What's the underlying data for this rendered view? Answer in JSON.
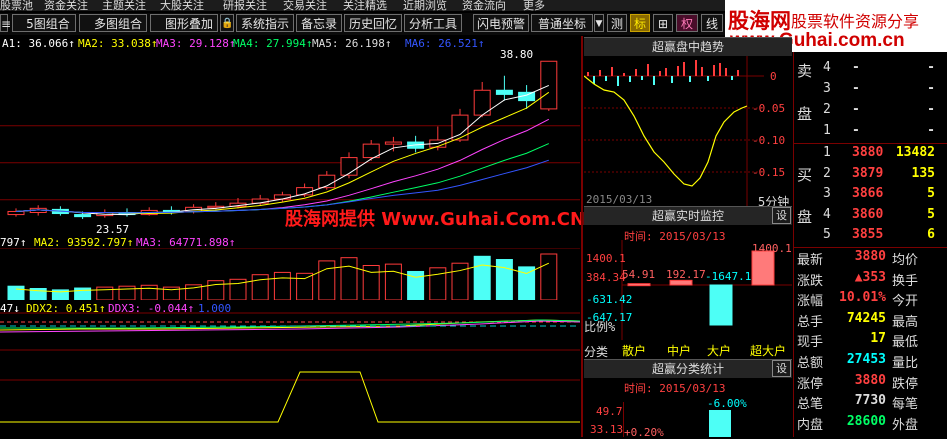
{
  "menu_top": [
    "股票池",
    "资金关注",
    "主题关注",
    "大股关注",
    "研报关注",
    "交易关注",
    "关注精选",
    "近期浏览",
    "资金流向",
    "更多"
  ],
  "toolbar": {
    "items": [
      "5图组合",
      "多图组合",
      "图形叠加",
      "系统指示",
      "备忘录",
      "历史回忆",
      "分析工具",
      "闪电预警",
      "普通坐标"
    ],
    "toggles": [
      "测",
      "标",
      "⊞",
      "权",
      "线"
    ]
  },
  "logo": {
    "main": "股海网",
    "sub": "股票软件资源分享",
    "url": "www.Guhai.com.cn"
  },
  "watermark": "股海网提供 Www.Guhai.Com.CN",
  "main_chart": {
    "ma_line": [
      "A1: 36.066↑",
      "MA2: 33.038↑",
      "MA3: 29.128↑",
      "MA4: 27.994↑",
      "MA5: 26.198↑",
      "MA6: 26.521↑"
    ],
    "ma_colors": [
      "#ffffff",
      "#ffff00",
      "#ff44ff",
      "#00ff66",
      "#dddddd",
      "#3355ff"
    ],
    "high_label": "38.80",
    "low_label": "23.57",
    "candles": [
      {
        "o": 24.0,
        "c": 24.3,
        "h": 24.6,
        "l": 23.8
      },
      {
        "o": 24.2,
        "c": 24.6,
        "h": 24.9,
        "l": 23.9
      },
      {
        "o": 24.5,
        "c": 24.1,
        "h": 24.8,
        "l": 23.9
      },
      {
        "o": 24.0,
        "c": 23.8,
        "h": 24.3,
        "l": 23.57
      },
      {
        "o": 23.9,
        "c": 24.2,
        "h": 24.5,
        "l": 23.7
      },
      {
        "o": 24.2,
        "c": 24.0,
        "h": 24.6,
        "l": 23.8
      },
      {
        "o": 24.0,
        "c": 24.4,
        "h": 24.7,
        "l": 23.9
      },
      {
        "o": 24.4,
        "c": 24.3,
        "h": 24.8,
        "l": 24.0
      },
      {
        "o": 24.3,
        "c": 24.7,
        "h": 25.0,
        "l": 24.1
      },
      {
        "o": 24.7,
        "c": 24.8,
        "h": 25.2,
        "l": 24.5
      },
      {
        "o": 24.8,
        "c": 25.1,
        "h": 25.6,
        "l": 24.6
      },
      {
        "o": 25.1,
        "c": 25.5,
        "h": 25.9,
        "l": 24.9
      },
      {
        "o": 25.5,
        "c": 25.9,
        "h": 26.2,
        "l": 25.2
      },
      {
        "o": 25.9,
        "c": 26.6,
        "h": 27.0,
        "l": 25.7
      },
      {
        "o": 26.6,
        "c": 27.8,
        "h": 28.2,
        "l": 26.4
      },
      {
        "o": 27.8,
        "c": 29.5,
        "h": 30.0,
        "l": 27.5
      },
      {
        "o": 29.5,
        "c": 30.8,
        "h": 31.2,
        "l": 29.2
      },
      {
        "o": 30.8,
        "c": 31.0,
        "h": 31.5,
        "l": 30.1
      },
      {
        "o": 31.0,
        "c": 30.4,
        "h": 31.6,
        "l": 30.0
      },
      {
        "o": 30.5,
        "c": 31.2,
        "h": 32.5,
        "l": 30.2
      },
      {
        "o": 31.2,
        "c": 33.6,
        "h": 34.2,
        "l": 31.0
      },
      {
        "o": 33.6,
        "c": 36.0,
        "h": 36.8,
        "l": 33.4
      },
      {
        "o": 36.0,
        "c": 35.6,
        "h": 37.4,
        "l": 35.0
      },
      {
        "o": 35.8,
        "c": 35.0,
        "h": 36.5,
        "l": 34.2
      },
      {
        "o": 34.2,
        "c": 38.8,
        "h": 38.8,
        "l": 34.0
      }
    ]
  },
  "volume_panel": {
    "ma_line": [
      "797↑",
      "MA2: 93592.797↑",
      "MA3: 64771.898↑"
    ],
    "bars": [
      {
        "v": 0.3,
        "up": false
      },
      {
        "v": 0.25,
        "up": false
      },
      {
        "v": 0.22,
        "up": false
      },
      {
        "v": 0.26,
        "up": false
      },
      {
        "v": 0.28,
        "up": true
      },
      {
        "v": 0.3,
        "up": true
      },
      {
        "v": 0.32,
        "up": true
      },
      {
        "v": 0.28,
        "up": true
      },
      {
        "v": 0.33,
        "up": true
      },
      {
        "v": 0.42,
        "up": true
      },
      {
        "v": 0.45,
        "up": true
      },
      {
        "v": 0.55,
        "up": true
      },
      {
        "v": 0.6,
        "up": true
      },
      {
        "v": 0.58,
        "up": true
      },
      {
        "v": 0.85,
        "up": true
      },
      {
        "v": 0.92,
        "up": true
      },
      {
        "v": 0.75,
        "up": true
      },
      {
        "v": 0.78,
        "up": true
      },
      {
        "v": 0.62,
        "up": false
      },
      {
        "v": 0.7,
        "up": true
      },
      {
        "v": 0.8,
        "up": true
      },
      {
        "v": 0.95,
        "up": false
      },
      {
        "v": 0.88,
        "up": false
      },
      {
        "v": 0.72,
        "up": false
      },
      {
        "v": 1.0,
        "up": true
      }
    ]
  },
  "ddx_panel": {
    "labels": [
      "47↓",
      "DDX2: 0.451↑",
      "DDX3: -0.044↑",
      "1.000"
    ]
  },
  "right_panels": {
    "trend_title": "超赢盘中趋势",
    "trend_date": "2015/03/13",
    "trend_period": "5分钟",
    "trend_axis": [
      "0",
      "-0.05",
      "-0.10",
      "-0.15"
    ],
    "monitor_title": "超赢实时监控",
    "monitor_time": "时间: 2015/03/13",
    "monitor_values": [
      "54.91",
      "192.17",
      "-1647.1",
      "1400.1"
    ],
    "monitor_axis": [
      "1400.1",
      "384.34",
      "-631.42",
      "-647.17"
    ],
    "ratio_label": "比例%",
    "category_label": "分类",
    "categories": [
      "散户",
      "中户",
      "大户",
      "超大户"
    ],
    "stats_title": "超赢分类统计",
    "stats_time": "时间: 2015/03/13",
    "stats_values": [
      "-6.00%",
      "+0.20%"
    ],
    "stats_axis": [
      "49.7",
      "33.13"
    ],
    "setting_label": "设"
  },
  "order_book": {
    "sell_label": [
      "卖",
      "盘"
    ],
    "buy_label": [
      "买",
      "盘"
    ],
    "sell": [
      {
        "lvl": "4",
        "price": "-",
        "vol": "-"
      },
      {
        "lvl": "3",
        "price": "-",
        "vol": "-"
      },
      {
        "lvl": "2",
        "price": "-",
        "vol": "-"
      },
      {
        "lvl": "1",
        "price": "-",
        "vol": "-"
      }
    ],
    "buy": [
      {
        "lvl": "1",
        "price": "3880",
        "vol": "13482"
      },
      {
        "lvl": "2",
        "price": "3879",
        "vol": "135"
      },
      {
        "lvl": "3",
        "price": "3866",
        "vol": "5"
      },
      {
        "lvl": "4",
        "price": "3860",
        "vol": "5"
      },
      {
        "lvl": "5",
        "price": "3855",
        "vol": "6"
      }
    ]
  },
  "quote_stats": [
    {
      "l": "最新",
      "v": "3880",
      "vc": "#ff4040",
      "r": "均价"
    },
    {
      "l": "涨跌",
      "v": "▲353",
      "vc": "#ff4040",
      "r": "换手"
    },
    {
      "l": "涨幅",
      "v": "10.01%",
      "vc": "#ff4040",
      "r": "今开"
    },
    {
      "l": "总手",
      "v": "74245",
      "vc": "#ffff00",
      "r": "最高"
    },
    {
      "l": "现手",
      "v": "17",
      "vc": "#ffff00",
      "r": "最低"
    },
    {
      "l": "总额",
      "v": "27453",
      "vc": "#00ffff",
      "r": "量比"
    },
    {
      "l": "涨停",
      "v": "3880",
      "vc": "#ff4040",
      "r": "跌停"
    },
    {
      "l": "总笔",
      "v": "7730",
      "vc": "#dddddd",
      "r": "每笔"
    },
    {
      "l": "内盘",
      "v": "28600",
      "vc": "#00ff66",
      "r": "外盘"
    }
  ],
  "colors": {
    "up": "#ff3b3b",
    "down": "#4dfff6",
    "bg": "#000000",
    "grid": "#7a0000",
    "accent": "#ffff00"
  }
}
